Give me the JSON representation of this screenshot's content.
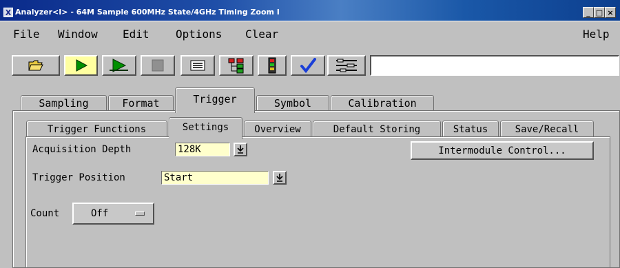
{
  "window": {
    "title": "Analyzer<I> - 64M Sample 600MHz State/4GHz Timing Zoom I",
    "app_icon_glyph": "X",
    "controls": {
      "minimize": "_",
      "maximize": "□",
      "close": "×"
    }
  },
  "menu": {
    "file": "File",
    "window": "Window",
    "edit": "Edit",
    "options": "Options",
    "clear": "Clear",
    "help": "Help"
  },
  "toolbar": {
    "buttons": [
      "folder-open-icon",
      "run-icon",
      "run-repetitive-icon",
      "stop-icon",
      "listing-icon",
      "waveform-icon",
      "module-icon",
      "check-icon",
      "settings-icon"
    ],
    "highlight_color": "#ffffa0",
    "play_color": "#008000",
    "check_color": "#1a3fd8",
    "command_field": ""
  },
  "tabs": [
    "Sampling",
    "Format",
    "Trigger",
    "Symbol",
    "Calibration"
  ],
  "active_tab": "Trigger",
  "subtabs": [
    "Trigger Functions",
    "Settings",
    "Overview",
    "Default Storing",
    "Status",
    "Save/Recall"
  ],
  "active_subtab": "Settings",
  "settings": {
    "acquisition_depth_label": "Acquisition Depth",
    "acquisition_depth_value": "128K",
    "intermodule_button": "Intermodule Control...",
    "trigger_position_label": "Trigger Position",
    "trigger_position_value": "Start",
    "count_label": "Count",
    "count_value": "Off"
  },
  "colors": {
    "field_bg": "#ffffcc",
    "panel_bg": "#c0c0c0",
    "title_bg": "#0a2a8a"
  }
}
